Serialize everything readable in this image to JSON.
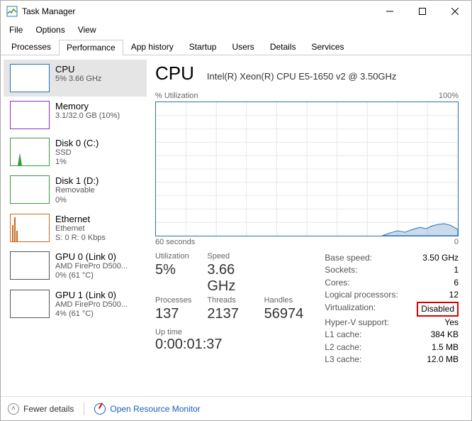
{
  "window": {
    "title": "Task Manager"
  },
  "menu": {
    "file": "File",
    "options": "Options",
    "view": "View"
  },
  "tabs": {
    "processes": "Processes",
    "performance": "Performance",
    "apphistory": "App history",
    "startup": "Startup",
    "users": "Users",
    "details": "Details",
    "services": "Services"
  },
  "sidebar": {
    "cpu": {
      "title": "CPU",
      "sub": "5% 3.66 GHz"
    },
    "memory": {
      "title": "Memory",
      "sub": "3.1/32.0 GB (10%)"
    },
    "disk0": {
      "title": "Disk 0 (C:)",
      "sub1": "SSD",
      "sub2": "1%"
    },
    "disk1": {
      "title": "Disk 1 (D:)",
      "sub1": "Removable",
      "sub2": "0%"
    },
    "eth": {
      "title": "Ethernet",
      "sub1": "Ethernet",
      "sub2": "S: 0 R: 0 Kbps"
    },
    "gpu0": {
      "title": "GPU 0 (Link 0)",
      "sub1": "AMD FirePro D500...",
      "sub2": "0% (61 °C)"
    },
    "gpu1": {
      "title": "GPU 1 (Link 0)",
      "sub1": "AMD FirePro D500...",
      "sub2": "4% (61 °C)"
    }
  },
  "main": {
    "heading": "CPU",
    "cpu_name": "Intel(R) Xeon(R) CPU E5-1650 v2 @ 3.50GHz",
    "chart_top_left": "% Utilization",
    "chart_top_right": "100%",
    "chart_bot_left": "60 seconds",
    "chart_bot_right": "0",
    "stats": {
      "utilization_label": "Utilization",
      "utilization_value": "5%",
      "speed_label": "Speed",
      "speed_value": "3.66 GHz",
      "processes_label": "Processes",
      "processes_value": "137",
      "threads_label": "Threads",
      "threads_value": "2137",
      "handles_label": "Handles",
      "handles_value": "56974",
      "uptime_label": "Up time",
      "uptime_value": "0:00:01:37"
    },
    "right": {
      "base_speed_k": "Base speed:",
      "base_speed_v": "3.50 GHz",
      "sockets_k": "Sockets:",
      "sockets_v": "1",
      "cores_k": "Cores:",
      "cores_v": "6",
      "logical_k": "Logical processors:",
      "logical_v": "12",
      "virt_k": "Virtualization:",
      "virt_v": "Disabled",
      "hv_k": "Hyper-V support:",
      "hv_v": "Yes",
      "l1_k": "L1 cache:",
      "l1_v": "384 KB",
      "l2_k": "L2 cache:",
      "l2_v": "1.5 MB",
      "l3_k": "L3 cache:",
      "l3_v": "12.0 MB"
    }
  },
  "footer": {
    "fewer": "Fewer details",
    "orm": "Open Resource Monitor"
  },
  "chart_data": {
    "type": "line",
    "title": "% Utilization",
    "xlabel": "seconds ago",
    "ylabel": "% Utilization",
    "xlim": [
      60,
      0
    ],
    "ylim": [
      0,
      100
    ],
    "x": [
      60,
      55,
      50,
      45,
      40,
      35,
      30,
      25,
      20,
      15,
      12,
      10,
      8,
      6,
      5,
      4,
      3,
      2,
      1,
      0
    ],
    "values": [
      0,
      0,
      0,
      0,
      0,
      0,
      0,
      0,
      0,
      0,
      2,
      4,
      3,
      5,
      7,
      6,
      8,
      9,
      8,
      5
    ]
  }
}
